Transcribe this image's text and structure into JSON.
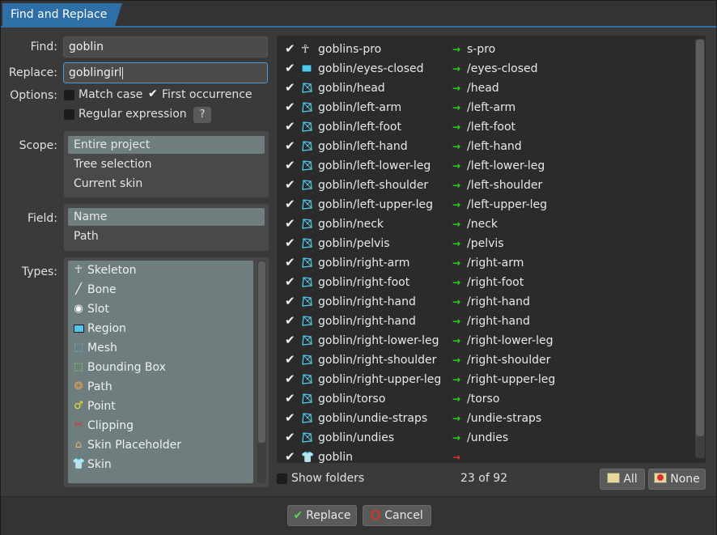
{
  "title": "Find and Replace",
  "find": {
    "label": "Find:",
    "value": "goblin"
  },
  "replace": {
    "label": "Replace:",
    "value": "goblingirl"
  },
  "options": {
    "label": "Options:",
    "match_case": "Match case",
    "match_case_checked": false,
    "first_occurrence": "First occurrence",
    "first_occurrence_checked": true,
    "regex": "Regular expression",
    "regex_checked": false,
    "help": "?"
  },
  "scope": {
    "label": "Scope:",
    "items": [
      "Entire project",
      "Tree selection",
      "Current skin"
    ],
    "selected": 0
  },
  "field": {
    "label": "Field:",
    "items": [
      "Name",
      "Path"
    ],
    "selected": 0
  },
  "types": {
    "label": "Types:",
    "items": [
      {
        "label": "Skeleton",
        "icon": "skeleton-icon"
      },
      {
        "label": "Bone",
        "icon": "bone-icon"
      },
      {
        "label": "Slot",
        "icon": "slot-icon"
      },
      {
        "label": "Region",
        "icon": "region-icon"
      },
      {
        "label": "Mesh",
        "icon": "mesh-icon"
      },
      {
        "label": "Bounding Box",
        "icon": "bounding-box-icon"
      },
      {
        "label": "Path",
        "icon": "path-icon"
      },
      {
        "label": "Point",
        "icon": "point-icon"
      },
      {
        "label": "Clipping",
        "icon": "clipping-icon"
      },
      {
        "label": "Skin Placeholder",
        "icon": "skin-placeholder-icon"
      },
      {
        "label": "Skin",
        "icon": "skin-icon"
      }
    ]
  },
  "results": [
    {
      "name": "goblins-pro",
      "to": "s-pro",
      "icon": "skeleton-icon"
    },
    {
      "name": "goblin/eyes-closed",
      "to": "/eyes-closed",
      "icon": "region-icon"
    },
    {
      "name": "goblin/head",
      "to": "/head",
      "icon": "mesh-icon"
    },
    {
      "name": "goblin/left-arm",
      "to": "/left-arm",
      "icon": "mesh-icon"
    },
    {
      "name": "goblin/left-foot",
      "to": "/left-foot",
      "icon": "mesh-icon"
    },
    {
      "name": "goblin/left-hand",
      "to": "/left-hand",
      "icon": "mesh-icon"
    },
    {
      "name": "goblin/left-lower-leg",
      "to": "/left-lower-leg",
      "icon": "mesh-icon"
    },
    {
      "name": "goblin/left-shoulder",
      "to": "/left-shoulder",
      "icon": "mesh-icon"
    },
    {
      "name": "goblin/left-upper-leg",
      "to": "/left-upper-leg",
      "icon": "mesh-icon"
    },
    {
      "name": "goblin/neck",
      "to": "/neck",
      "icon": "mesh-icon"
    },
    {
      "name": "goblin/pelvis",
      "to": "/pelvis",
      "icon": "mesh-icon"
    },
    {
      "name": "goblin/right-arm",
      "to": "/right-arm",
      "icon": "mesh-icon"
    },
    {
      "name": "goblin/right-foot",
      "to": "/right-foot",
      "icon": "mesh-icon"
    },
    {
      "name": "goblin/right-hand",
      "to": "/right-hand",
      "icon": "mesh-icon"
    },
    {
      "name": "goblin/right-hand",
      "to": "/right-hand",
      "icon": "mesh-icon"
    },
    {
      "name": "goblin/right-lower-leg",
      "to": "/right-lower-leg",
      "icon": "mesh-icon"
    },
    {
      "name": "goblin/right-shoulder",
      "to": "/right-shoulder",
      "icon": "mesh-icon"
    },
    {
      "name": "goblin/right-upper-leg",
      "to": "/right-upper-leg",
      "icon": "mesh-icon"
    },
    {
      "name": "goblin/torso",
      "to": "/torso",
      "icon": "mesh-icon"
    },
    {
      "name": "goblin/undie-straps",
      "to": "/undie-straps",
      "icon": "mesh-icon"
    },
    {
      "name": "goblin/undies",
      "to": "/undies",
      "icon": "mesh-icon"
    },
    {
      "name": "goblin",
      "to": "",
      "icon": "skin-icon",
      "arrow": "red"
    }
  ],
  "show_folders": {
    "label": "Show folders",
    "checked": false
  },
  "count": "23 of 92",
  "all_button": "All",
  "none_button": "None",
  "replace_button": "Replace",
  "cancel_button": "Cancel",
  "colors": {
    "accent": "#2f6fa8",
    "arrow_ok": "#22dd22",
    "arrow_bad": "#e03030",
    "mesh": "#4fc8e8",
    "selected": "#6e7e7e"
  }
}
